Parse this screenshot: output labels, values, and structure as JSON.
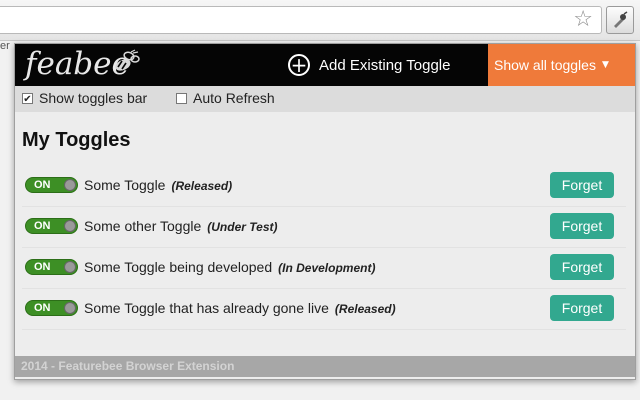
{
  "browser": {
    "bookmark_icon": "star-icon",
    "extension_icon": "feabee-extension-icon",
    "background_fragment": "er"
  },
  "popup": {
    "logo_text": "feabee",
    "logo_icon": "bee-icon",
    "add_toggle_label": "Add Existing Toggle",
    "show_all_label": "Show all toggles",
    "colors": {
      "header": "#050505",
      "accent": "#ef7a3a",
      "forget": "#32a88f",
      "on": "#3d8f25"
    },
    "options": {
      "show_bar_label": "Show toggles bar",
      "show_bar_checked": true,
      "auto_refresh_label": "Auto Refresh",
      "auto_refresh_checked": false
    },
    "list_title": "My Toggles",
    "toggles": [
      {
        "state": "ON",
        "name": "Some Toggle",
        "status": "(Released)",
        "action": "Forget"
      },
      {
        "state": "ON",
        "name": "Some other Toggle",
        "status": "(Under Test)",
        "action": "Forget"
      },
      {
        "state": "ON",
        "name": "Some Toggle being developed",
        "status": "(In Development)",
        "action": "Forget"
      },
      {
        "state": "ON",
        "name": "Some Toggle that has already gone live",
        "status": "(Released)",
        "action": "Forget"
      }
    ],
    "footer": "2014 - Featurebee Browser Extension"
  }
}
